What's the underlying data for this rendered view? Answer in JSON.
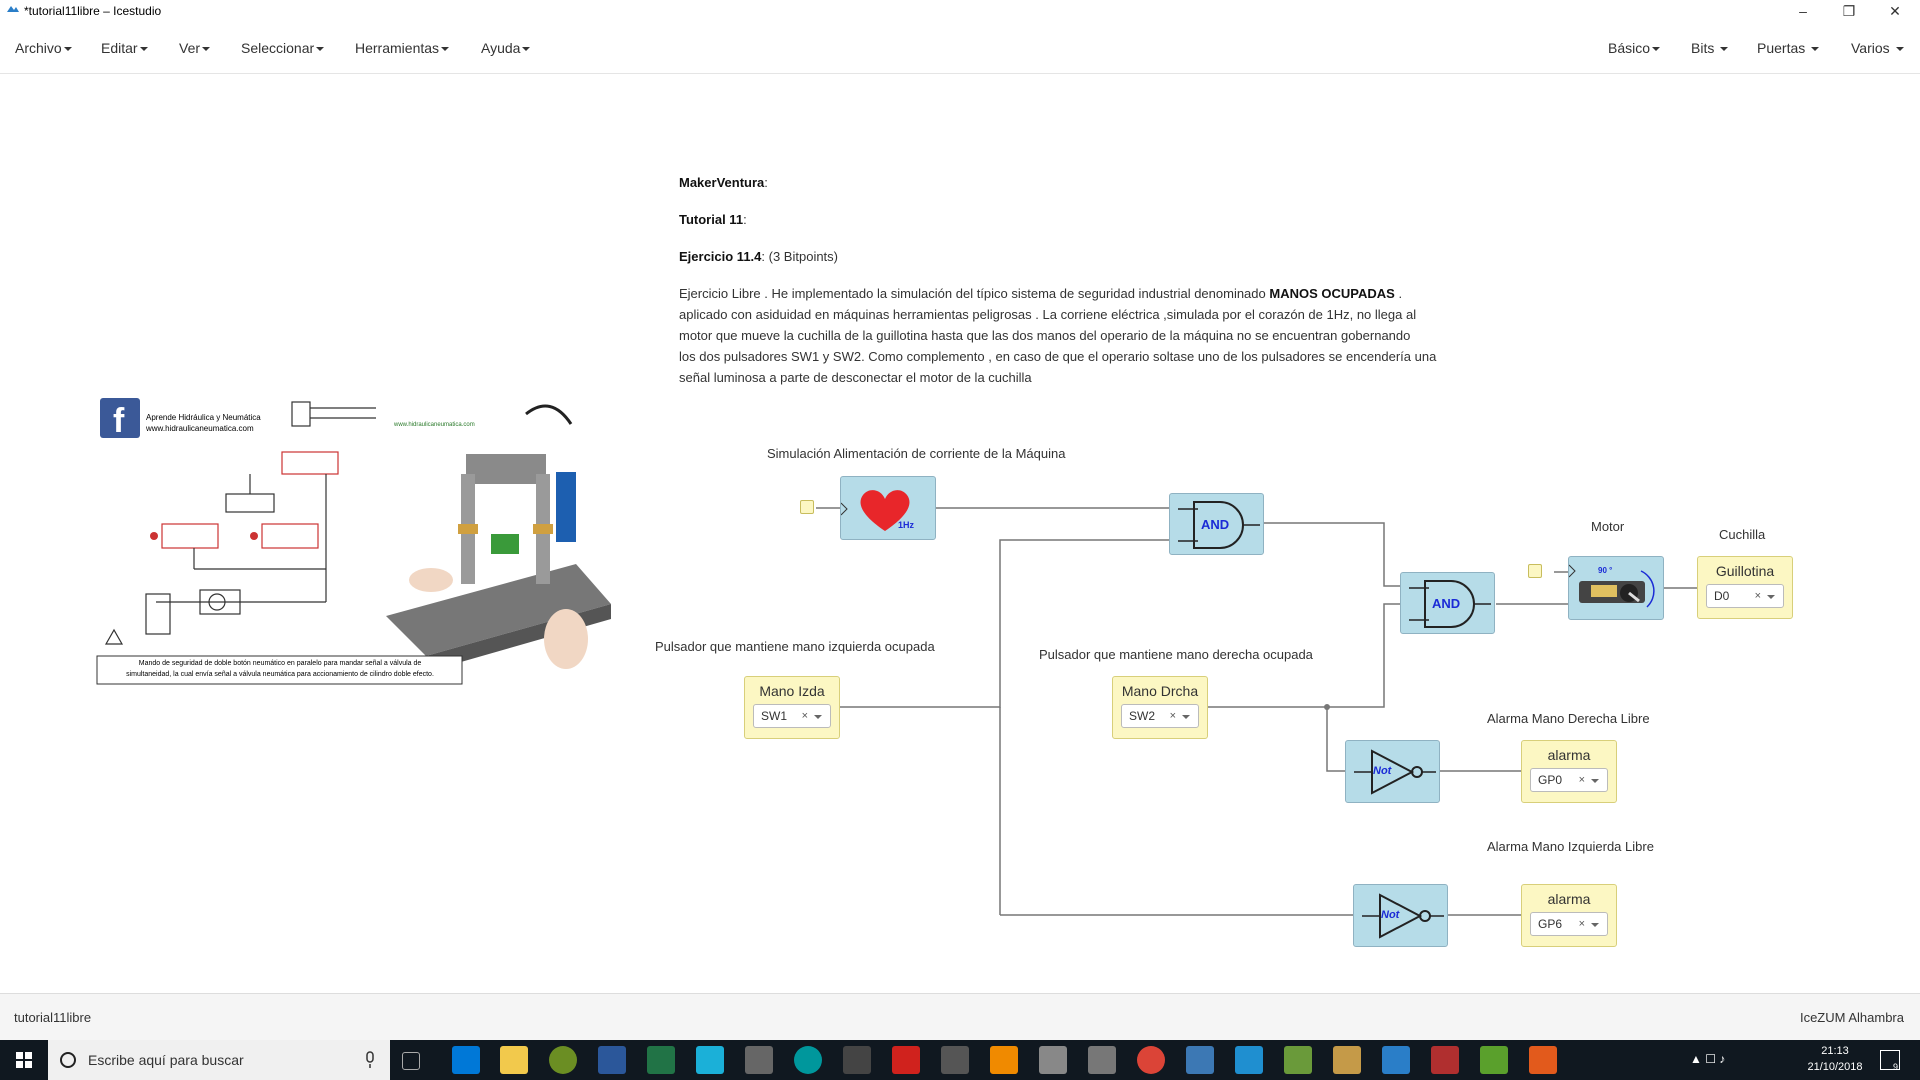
{
  "window": {
    "title": "*tutorial11libre – Icestudio"
  },
  "menubar": {
    "left": [
      "Archivo",
      "Editar",
      "Ver",
      "Seleccionar",
      "Herramientas",
      "Ayuda"
    ],
    "right": [
      "Básico",
      "Bits",
      "Puertas",
      "Varios"
    ]
  },
  "info": {
    "author": "MakerVentura",
    "tutorial": "Tutorial 11",
    "exercise": "Ejercicio 11.4",
    "points": "(3 Bitpoints)",
    "p1": "Ejercicio Libre . He implementado la simulación del típico sistema de seguridad industrial denominado",
    "p1_bold": "MANOS OCUPADAS",
    "p1_end": ".",
    "lines": [
      "aplicado con asiduidad en máquinas herramientas peligrosas . La corriene eléctrica ,simulada por el corazón de 1Hz, no llega al",
      "motor que mueve la cuchilla de la guillotina hasta que las dos manos del operario de la máquina no se encuentran gobernando",
      "los dos pulsadores SW1 y SW2. Como complemento , en caso de que el operario soltase uno de los pulsadores se encendería una",
      "señal luminosa a parte de desconectar el motor de la cuchilla"
    ]
  },
  "image": {
    "fb_title": "Aprende Hidráulica y Neumática",
    "fb_url": "www.hidraulicaneumatica.com",
    "watermark": "www.hidraulicaneumatica.com",
    "caption1": "Mando de seguridad de doble botón neumático en paralelo para mandar señal a válvula de",
    "caption2": "simultaneidad, la cual envía señal a válvula neumática para accionamiento de cilindro doble efecto."
  },
  "circuit": {
    "sim_label": "Simulación Alimentación de corriente de la Máquina",
    "heart_text": "1Hz",
    "left_label": "Pulsador que mantiene mano izquierda ocupada",
    "right_label": "Pulsador que mantiene mano derecha ocupada",
    "motor_label": "Motor",
    "motor_angle": "90 °",
    "cuchilla_label": "Cuchilla",
    "alarm_r_label": "Alarma Mano Derecha Libre",
    "alarm_l_label": "Alarma Mano Izquierda Libre",
    "and1": "AND",
    "and2": "AND",
    "not1": "Not",
    "not2": "Not",
    "io": {
      "izda": {
        "name": "Mano Izda",
        "pin": "SW1"
      },
      "drcha": {
        "name": "Mano Drcha",
        "pin": "SW2"
      },
      "guillotina": {
        "name": "Guillotina",
        "pin": "D0"
      },
      "alarma1": {
        "name": "alarma",
        "pin": "GP0"
      },
      "alarma2": {
        "name": "alarma",
        "pin": "GP6"
      }
    }
  },
  "status": {
    "left": "tutorial11libre",
    "right": "IceZUM Alhambra"
  },
  "taskbar": {
    "search_placeholder": "Escribe aquí para buscar",
    "time": "21:13",
    "date": "21/10/2018",
    "notif_count": "9"
  },
  "colors": {
    "block": "#b6dce8",
    "io": "#fcf7c3",
    "wire": "#777777",
    "taskbar": "#101820"
  }
}
